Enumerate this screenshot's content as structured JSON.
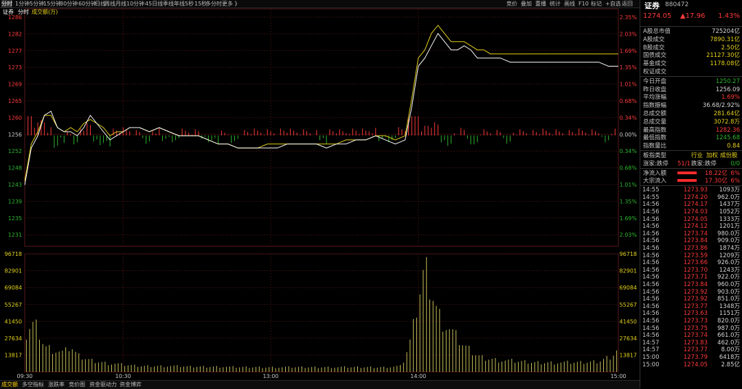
{
  "toolbar": {
    "left": [
      "分时",
      "1分钟",
      "5分钟",
      "15分钟",
      "30分钟",
      "60分钟",
      "日线",
      "周线",
      "月线",
      "10分钟",
      "45日线",
      "季线",
      "年线",
      "5秒",
      "15秒",
      "多分时",
      "更多 》"
    ],
    "right": [
      "竞价",
      "叠加",
      "重播",
      "统计",
      "画线",
      "F10",
      "标记",
      "+自选",
      "返回"
    ]
  },
  "chart_header": {
    "name": "证券",
    "tab1": "分时",
    "tab2": "成交额(万)"
  },
  "price_axis_left": [
    "1286",
    "1282",
    "1277",
    "1273",
    "1269",
    "1265",
    "1260",
    "1256",
    "1252",
    "1248",
    "1243",
    "1239",
    "1235",
    "1231"
  ],
  "pct_axis_right": [
    "2.35%",
    "2.03%",
    "1.69%",
    "1.35%",
    "1.01%",
    "0.68%",
    "0.34%",
    "0.00%",
    "0.34%",
    "0.68%",
    "1.01%",
    "1.35%",
    "1.69%",
    "2.03%"
  ],
  "vol_axis": [
    "96718",
    "82901",
    "69084",
    "55267",
    "41450",
    "27634",
    "13817"
  ],
  "time_axis": [
    "09:30",
    "10:30",
    "13:00",
    "14:00",
    "15:00"
  ],
  "bottom_tabs": [
    "成交额",
    "多空指标",
    "涨跌率",
    "竞价图",
    "资金驱动力",
    "资金博弈"
  ],
  "colors": {
    "up": "#ff3b3b",
    "down": "#2fb72f",
    "white_line": "#ffffff",
    "yellow_line": "#e6d21a",
    "volume": "#c9c25a",
    "grid": "#3a1010"
  },
  "panel": {
    "name": "证券",
    "code": "880472",
    "price": "1274.05",
    "change": "▲17.96",
    "pct": "1.43%",
    "stats1": [
      {
        "label": "A股总市值",
        "value": "725204亿",
        "color": "#d6d6d6"
      },
      {
        "label": "A股成交",
        "value": "7890.31亿",
        "color": "#e6d21a"
      },
      {
        "label": "B股成交",
        "value": "2.50亿",
        "color": "#e6d21a"
      },
      {
        "label": "国债成交",
        "value": "21127.30亿",
        "color": "#e6d21a"
      },
      {
        "label": "基金成交",
        "value": "1178.08亿",
        "color": "#e6d21a"
      },
      {
        "label": "权证成交",
        "value": "",
        "color": "#e6d21a"
      }
    ],
    "stats2": [
      {
        "label": "今日开盘",
        "value": "1250.27",
        "color": "#2fb72f"
      },
      {
        "label": "昨日收盘",
        "value": "1256.09",
        "color": "#d6d6d6"
      },
      {
        "label": "平均涨幅",
        "value": "1.69%",
        "color": "#ff3b3b"
      },
      {
        "label": "指数振幅",
        "value": "36.68/2.92%",
        "color": "#d6d6d6"
      },
      {
        "label": "总成交额",
        "value": "281.64亿",
        "color": "#e6d21a"
      },
      {
        "label": "总成交量",
        "value": "3072.8万",
        "color": "#e6d21a"
      },
      {
        "label": "最高指数",
        "value": "1282.36",
        "color": "#ff3b3b"
      },
      {
        "label": "最低指数",
        "value": "1245.68",
        "color": "#2fb72f"
      },
      {
        "label": "指数量比",
        "value": "0.84",
        "color": "#e6d21a"
      }
    ],
    "sector": {
      "label": "板指类型",
      "v1": "行业",
      "v2": "加权",
      "v3": "成份股"
    },
    "limit": {
      "label1": "涨家:跌停",
      "v1": "51/1",
      "label2": "跌家:跌停",
      "v2": "0/0"
    },
    "flow": [
      {
        "label": "净流入额",
        "value": "18.22亿",
        "pct": "6%",
        "fill": 0.6
      },
      {
        "label": "大宗流入",
        "value": "17.30亿",
        "pct": "6%",
        "fill": 0.6
      }
    ],
    "ticks": [
      {
        "t": "14:55",
        "p": "1273.93",
        "v": "1093万"
      },
      {
        "t": "14:55",
        "p": "1274.20",
        "v": "962.0万"
      },
      {
        "t": "14:56",
        "p": "1274.17",
        "v": "1437万"
      },
      {
        "t": "14:56",
        "p": "1274.03",
        "v": "1052万"
      },
      {
        "t": "14:56",
        "p": "1274.05",
        "v": "1333万"
      },
      {
        "t": "14:56",
        "p": "1274.12",
        "v": "1201万"
      },
      {
        "t": "14:56",
        "p": "1273.74",
        "v": "980.0万"
      },
      {
        "t": "14:56",
        "p": "1273.84",
        "v": "909.0万"
      },
      {
        "t": "14:56",
        "p": "1273.86",
        "v": "1874万"
      },
      {
        "t": "14:56",
        "p": "1273.59",
        "v": "1209万"
      },
      {
        "t": "14:56",
        "p": "1273.66",
        "v": "926.0万"
      },
      {
        "t": "14:56",
        "p": "1273.70",
        "v": "1243万"
      },
      {
        "t": "14:56",
        "p": "1273.71",
        "v": "922.0万"
      },
      {
        "t": "14:56",
        "p": "1273.84",
        "v": "960.0万"
      },
      {
        "t": "14:56",
        "p": "1273.92",
        "v": "903.0万"
      },
      {
        "t": "14:56",
        "p": "1273.92",
        "v": "851.0万"
      },
      {
        "t": "14:56",
        "p": "1273.77",
        "v": "1348万"
      },
      {
        "t": "14:56",
        "p": "1273.63",
        "v": "1151万"
      },
      {
        "t": "14:56",
        "p": "1273.73",
        "v": "820.0万"
      },
      {
        "t": "14:56",
        "p": "1273.75",
        "v": "987.0万"
      },
      {
        "t": "14:56",
        "p": "1273.74",
        "v": "661.0万"
      },
      {
        "t": "14:57",
        "p": "1273.83",
        "v": "462.0万"
      },
      {
        "t": "14:57",
        "p": "1273.77",
        "v": "8.00万"
      },
      {
        "t": "15:00",
        "p": "1273.79",
        "v": "6418万"
      },
      {
        "t": "15:00",
        "p": "1274.05",
        "v": "2.85亿"
      }
    ]
  },
  "chart_data": {
    "type": "line",
    "price_range": [
      1229,
      1287
    ],
    "prev_close": 1256.09,
    "volume_max": 96718,
    "white_line": [
      [
        0,
        1244
      ],
      [
        4,
        1253
      ],
      [
        8,
        1256
      ],
      [
        12,
        1261
      ],
      [
        16,
        1262
      ],
      [
        20,
        1258
      ],
      [
        24,
        1257
      ],
      [
        28,
        1257
      ],
      [
        32,
        1256
      ],
      [
        36,
        1258
      ],
      [
        40,
        1261
      ],
      [
        44,
        1259
      ],
      [
        48,
        1257
      ],
      [
        52,
        1255
      ],
      [
        56,
        1256
      ],
      [
        60,
        1257
      ],
      [
        64,
        1258
      ],
      [
        70,
        1258
      ],
      [
        76,
        1257
      ],
      [
        82,
        1258
      ],
      [
        88,
        1257
      ],
      [
        94,
        1256
      ],
      [
        100,
        1256
      ],
      [
        106,
        1256
      ],
      [
        112,
        1255
      ],
      [
        118,
        1254
      ],
      [
        124,
        1254
      ],
      [
        130,
        1253
      ],
      [
        136,
        1253
      ],
      [
        142,
        1253
      ],
      [
        148,
        1253
      ],
      [
        154,
        1253
      ],
      [
        160,
        1254
      ],
      [
        166,
        1254
      ],
      [
        172,
        1254
      ],
      [
        178,
        1254
      ],
      [
        184,
        1253
      ],
      [
        190,
        1254
      ],
      [
        196,
        1254
      ],
      [
        202,
        1255
      ],
      [
        208,
        1255
      ],
      [
        214,
        1256
      ],
      [
        220,
        1255
      ],
      [
        226,
        1254
      ],
      [
        232,
        1255
      ],
      [
        236,
        1263
      ],
      [
        240,
        1273
      ],
      [
        244,
        1275
      ],
      [
        248,
        1278
      ],
      [
        252,
        1281
      ],
      [
        256,
        1279
      ],
      [
        260,
        1277
      ],
      [
        264,
        1277
      ],
      [
        268,
        1278
      ],
      [
        272,
        1277
      ],
      [
        276,
        1275
      ],
      [
        280,
        1275
      ],
      [
        284,
        1275
      ],
      [
        290,
        1275
      ],
      [
        296,
        1274
      ],
      [
        302,
        1274
      ],
      [
        308,
        1274
      ],
      [
        314,
        1274
      ],
      [
        320,
        1274
      ],
      [
        326,
        1274
      ],
      [
        332,
        1274
      ],
      [
        338,
        1274
      ],
      [
        344,
        1274
      ],
      [
        350,
        1274
      ],
      [
        356,
        1273
      ],
      [
        362,
        1273
      ]
    ],
    "yellow_line": [
      [
        0,
        1245
      ],
      [
        4,
        1254
      ],
      [
        8,
        1257
      ],
      [
        12,
        1261
      ],
      [
        16,
        1261
      ],
      [
        20,
        1258
      ],
      [
        24,
        1257
      ],
      [
        28,
        1258
      ],
      [
        32,
        1257
      ],
      [
        36,
        1259
      ],
      [
        40,
        1260
      ],
      [
        44,
        1259
      ],
      [
        48,
        1258
      ],
      [
        52,
        1256
      ],
      [
        56,
        1257
      ],
      [
        60,
        1257
      ],
      [
        64,
        1258
      ],
      [
        70,
        1258
      ],
      [
        76,
        1257
      ],
      [
        82,
        1258
      ],
      [
        88,
        1257
      ],
      [
        94,
        1256
      ],
      [
        100,
        1256
      ],
      [
        106,
        1256
      ],
      [
        112,
        1255
      ],
      [
        118,
        1254
      ],
      [
        124,
        1254
      ],
      [
        130,
        1253
      ],
      [
        136,
        1253
      ],
      [
        142,
        1253
      ],
      [
        148,
        1254
      ],
      [
        154,
        1254
      ],
      [
        160,
        1254
      ],
      [
        166,
        1254
      ],
      [
        172,
        1254
      ],
      [
        178,
        1254
      ],
      [
        184,
        1254
      ],
      [
        190,
        1254
      ],
      [
        196,
        1255
      ],
      [
        202,
        1255
      ],
      [
        208,
        1255
      ],
      [
        214,
        1256
      ],
      [
        220,
        1256
      ],
      [
        226,
        1255
      ],
      [
        232,
        1256
      ],
      [
        236,
        1265
      ],
      [
        240,
        1275
      ],
      [
        244,
        1277
      ],
      [
        248,
        1281
      ],
      [
        252,
        1283
      ],
      [
        256,
        1281
      ],
      [
        260,
        1279
      ],
      [
        264,
        1279
      ],
      [
        268,
        1279
      ],
      [
        272,
        1278
      ],
      [
        276,
        1277
      ],
      [
        280,
        1277
      ],
      [
        284,
        1276
      ],
      [
        290,
        1276
      ],
      [
        296,
        1276
      ],
      [
        302,
        1276
      ],
      [
        308,
        1276
      ],
      [
        314,
        1276
      ],
      [
        320,
        1276
      ],
      [
        326,
        1276
      ],
      [
        332,
        1276
      ],
      [
        338,
        1276
      ],
      [
        344,
        1276
      ],
      [
        350,
        1276
      ],
      [
        356,
        1276
      ],
      [
        362,
        1276
      ]
    ],
    "volume": [
      [
        0,
        30000
      ],
      [
        4,
        42000
      ],
      [
        8,
        38000
      ],
      [
        12,
        22000
      ],
      [
        16,
        20000
      ],
      [
        20,
        18000
      ],
      [
        24,
        16000
      ],
      [
        28,
        22000
      ],
      [
        32,
        14000
      ],
      [
        36,
        12000
      ],
      [
        40,
        10000
      ],
      [
        44,
        9000
      ],
      [
        48,
        8000
      ],
      [
        52,
        7000
      ],
      [
        56,
        7000
      ],
      [
        60,
        6000
      ],
      [
        70,
        5000
      ],
      [
        80,
        5000
      ],
      [
        90,
        5000
      ],
      [
        100,
        4500
      ],
      [
        110,
        4500
      ],
      [
        120,
        4500
      ],
      [
        130,
        4000
      ],
      [
        140,
        4000
      ],
      [
        150,
        4000
      ],
      [
        160,
        4000
      ],
      [
        170,
        4000
      ],
      [
        180,
        4000
      ],
      [
        190,
        4000
      ],
      [
        200,
        4000
      ],
      [
        210,
        4000
      ],
      [
        220,
        4000
      ],
      [
        230,
        5000
      ],
      [
        236,
        30000
      ],
      [
        240,
        64000
      ],
      [
        244,
        90000
      ],
      [
        248,
        72000
      ],
      [
        252,
        50000
      ],
      [
        256,
        42000
      ],
      [
        260,
        35000
      ],
      [
        264,
        28000
      ],
      [
        268,
        22000
      ],
      [
        272,
        18000
      ],
      [
        276,
        14000
      ],
      [
        280,
        12000
      ],
      [
        290,
        10000
      ],
      [
        300,
        9000
      ],
      [
        310,
        8000
      ],
      [
        320,
        8000
      ],
      [
        330,
        8000
      ],
      [
        340,
        8000
      ],
      [
        350,
        9000
      ],
      [
        358,
        14000
      ],
      [
        362,
        20000
      ]
    ]
  }
}
